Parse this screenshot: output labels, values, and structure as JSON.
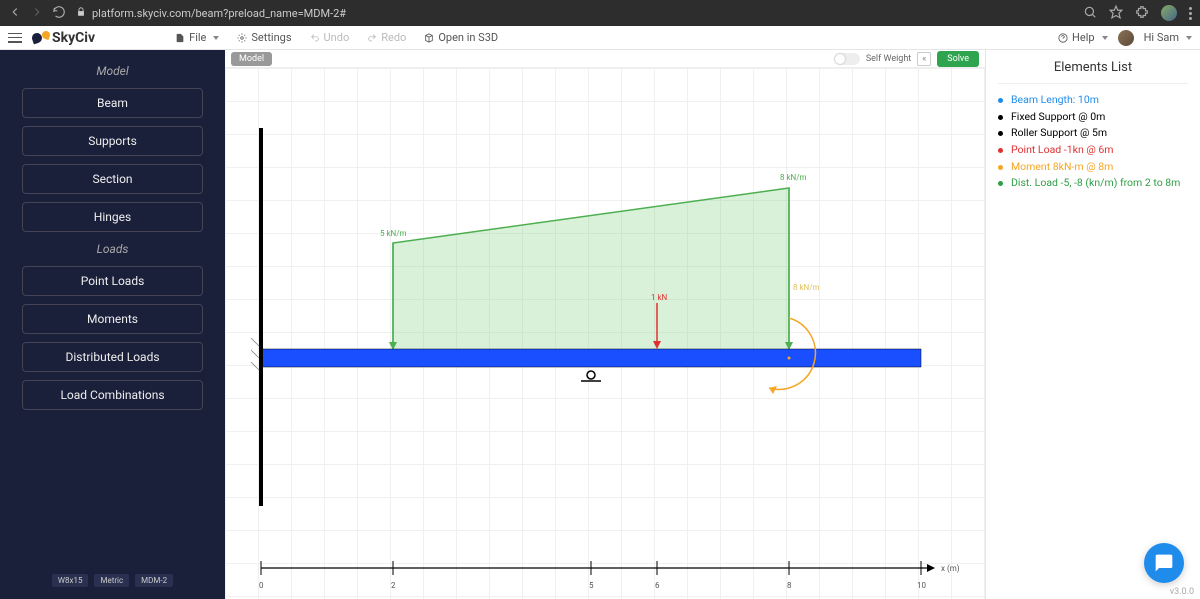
{
  "browser": {
    "url": "platform.skyciv.com/beam?preload_name=MDM-2#"
  },
  "appbar": {
    "brand": "SkyCiv",
    "file": "File",
    "settings": "Settings",
    "undo": "Undo",
    "redo": "Redo",
    "open_s3d": "Open in S3D",
    "help": "Help",
    "greeting": "Hi Sam"
  },
  "sidebar": {
    "header_model": "Model",
    "beam": "Beam",
    "supports": "Supports",
    "section": "Section",
    "hinges": "Hinges",
    "header_loads": "Loads",
    "point_loads": "Point Loads",
    "moments": "Moments",
    "dist_loads": "Distributed Loads",
    "load_combos": "Load Combinations",
    "chip1": "W8x15",
    "chip2": "Metric",
    "chip3": "MDM-2"
  },
  "canvas": {
    "tab": "Model",
    "self_weight": "Self Weight",
    "solve": "Solve",
    "labels": {
      "dist_start": "5 kN/m",
      "dist_end": "8 kN/m",
      "dist_end2": "8 kN/m",
      "point_load": "1 kN",
      "axis": "x (m)",
      "t0": "0",
      "t2": "2",
      "t5": "5",
      "t6": "6",
      "t8": "8",
      "t10": "10"
    }
  },
  "right": {
    "title": "Elements List",
    "items": [
      {
        "text": "Beam Length: 10m",
        "color": "#1f8ceb"
      },
      {
        "text": "Fixed Support @ 0m",
        "color": "#000000"
      },
      {
        "text": "Roller Support @ 5m",
        "color": "#000000"
      },
      {
        "text": "Point Load -1kn @ 6m",
        "color": "#e03131"
      },
      {
        "text": "Moment 8kN-m @ 8m",
        "color": "#f5a623"
      },
      {
        "text": "Dist. Load -5, -8 (kn/m) from 2 to 8m",
        "color": "#2f9e44"
      }
    ]
  },
  "version": "v3.0.0"
}
